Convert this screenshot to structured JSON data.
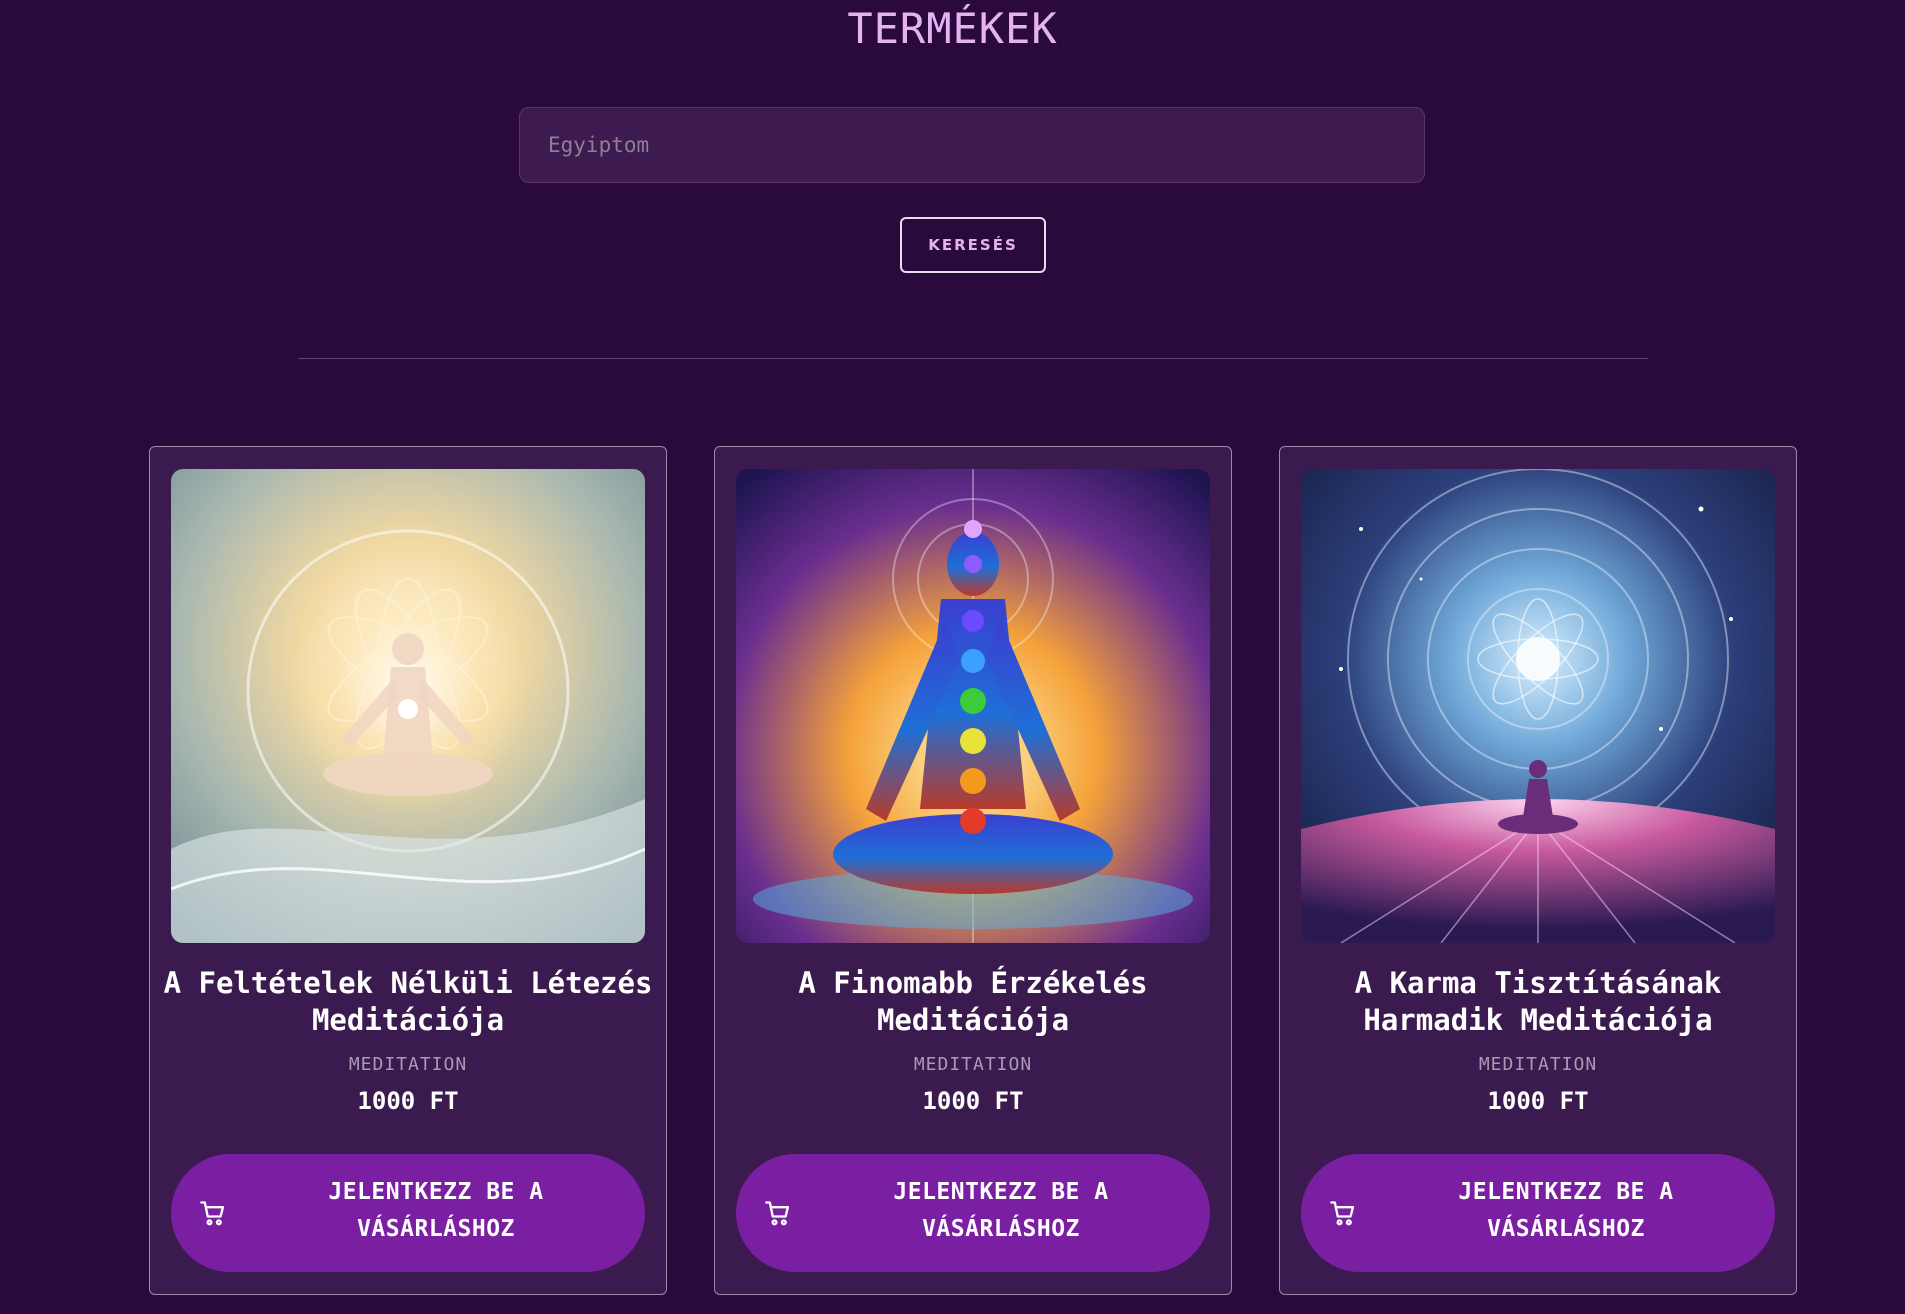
{
  "page": {
    "title": "TERMÉKEK"
  },
  "search": {
    "placeholder": "Egyiptom",
    "value": "",
    "button_label": "KERESÉS"
  },
  "colors": {
    "background": "#2a0a3c",
    "card_background": "#3b1a4f",
    "accent": "#7b1fa2",
    "title": "#e6b3f2"
  },
  "products": [
    {
      "title": "A Feltételek Nélküli Létezés Meditációja",
      "category": "MEDITATION",
      "price": "1000 FT",
      "button_label": "JELENTKEZZ BE A VÁSÁRLÁSHOZ",
      "image": "golden-light-meditation-figure",
      "icon": "cart-icon"
    },
    {
      "title": "A Finomabb Érzékelés Meditációja",
      "category": "MEDITATION",
      "price": "1000 FT",
      "button_label": "JELENTKEZZ BE A VÁSÁRLÁSHOZ",
      "image": "chakra-meditation-figure",
      "icon": "cart-icon"
    },
    {
      "title": "A Karma Tisztításának Harmadik Meditációja",
      "category": "MEDITATION",
      "price": "1000 FT",
      "button_label": "JELENTKEZZ BE A VÁSÁRLÁSHOZ",
      "image": "cosmic-mandala-meditation-figure",
      "icon": "cart-icon"
    }
  ]
}
